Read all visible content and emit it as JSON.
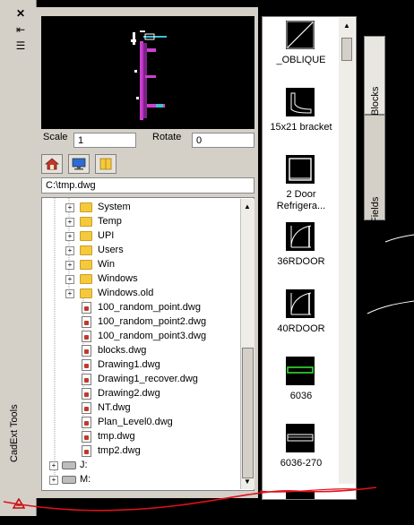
{
  "left_toolbar": {
    "title": "CadExt Tools",
    "close_glyph": "✕",
    "autohide_glyph": "⇤",
    "properties_glyph": "☰"
  },
  "preview": {
    "image": "drawing-preview"
  },
  "scale": {
    "label": "Scale",
    "value": "1"
  },
  "rotate": {
    "label": "Rotate",
    "value": "0"
  },
  "toolbar_icons": [
    "home-icon",
    "desktop-icon",
    "folder-icon"
  ],
  "path": {
    "value": "C:\\tmp.dwg"
  },
  "tree": {
    "folders": [
      "System",
      "Temp",
      "UPI",
      "Users",
      "Win",
      "Windows",
      "Windows.old"
    ],
    "files": [
      "100_random_point.dwg",
      "100_random_point2.dwg",
      "100_random_point3.dwg",
      "blocks.dwg",
      "Drawing1.dwg",
      "Drawing1_recover.dwg",
      "Drawing2.dwg",
      "NT.dwg",
      "Plan_Level0.dwg",
      "tmp.dwg",
      "tmp2.dwg"
    ],
    "drives": [
      "J:",
      "M:"
    ]
  },
  "blocks": [
    {
      "name": "_OBLIQUE",
      "icon": "oblique-icon"
    },
    {
      "name": "15x21 bracket",
      "icon": "bracket-icon"
    },
    {
      "name": "2 Door Refrigera...",
      "icon": "refrigerator-icon"
    },
    {
      "name": "36RDOOR",
      "icon": "door-icon"
    },
    {
      "name": "40RDOOR",
      "icon": "door-icon"
    },
    {
      "name": "6036",
      "icon": "green-bar-icon"
    },
    {
      "name": "6036-270",
      "icon": "bar-icon"
    }
  ],
  "tabs": {
    "blocks": "Blocks",
    "fields": "Fields"
  },
  "colors": {
    "annotation": "#e0101a",
    "preview_magenta": "#d040d0",
    "panel": "#d4d0c8"
  }
}
